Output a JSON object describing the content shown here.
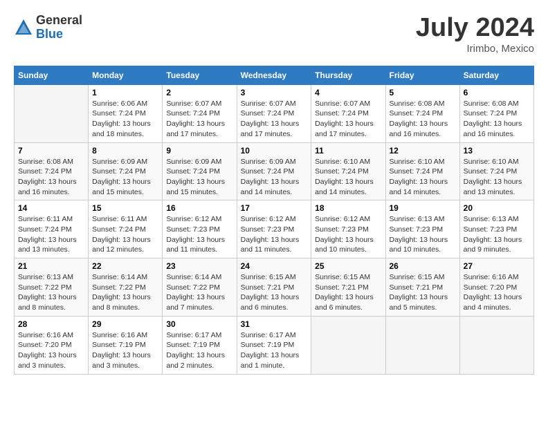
{
  "header": {
    "logo_general": "General",
    "logo_blue": "Blue",
    "month": "July 2024",
    "location": "Irimbo, Mexico"
  },
  "days_of_week": [
    "Sunday",
    "Monday",
    "Tuesday",
    "Wednesday",
    "Thursday",
    "Friday",
    "Saturday"
  ],
  "weeks": [
    [
      {
        "day": "",
        "sunrise": "",
        "sunset": "",
        "daylight": ""
      },
      {
        "day": "1",
        "sunrise": "Sunrise: 6:06 AM",
        "sunset": "Sunset: 7:24 PM",
        "daylight": "Daylight: 13 hours and 18 minutes."
      },
      {
        "day": "2",
        "sunrise": "Sunrise: 6:07 AM",
        "sunset": "Sunset: 7:24 PM",
        "daylight": "Daylight: 13 hours and 17 minutes."
      },
      {
        "day": "3",
        "sunrise": "Sunrise: 6:07 AM",
        "sunset": "Sunset: 7:24 PM",
        "daylight": "Daylight: 13 hours and 17 minutes."
      },
      {
        "day": "4",
        "sunrise": "Sunrise: 6:07 AM",
        "sunset": "Sunset: 7:24 PM",
        "daylight": "Daylight: 13 hours and 17 minutes."
      },
      {
        "day": "5",
        "sunrise": "Sunrise: 6:08 AM",
        "sunset": "Sunset: 7:24 PM",
        "daylight": "Daylight: 13 hours and 16 minutes."
      },
      {
        "day": "6",
        "sunrise": "Sunrise: 6:08 AM",
        "sunset": "Sunset: 7:24 PM",
        "daylight": "Daylight: 13 hours and 16 minutes."
      }
    ],
    [
      {
        "day": "7",
        "sunrise": "Sunrise: 6:08 AM",
        "sunset": "Sunset: 7:24 PM",
        "daylight": "Daylight: 13 hours and 16 minutes."
      },
      {
        "day": "8",
        "sunrise": "Sunrise: 6:09 AM",
        "sunset": "Sunset: 7:24 PM",
        "daylight": "Daylight: 13 hours and 15 minutes."
      },
      {
        "day": "9",
        "sunrise": "Sunrise: 6:09 AM",
        "sunset": "Sunset: 7:24 PM",
        "daylight": "Daylight: 13 hours and 15 minutes."
      },
      {
        "day": "10",
        "sunrise": "Sunrise: 6:09 AM",
        "sunset": "Sunset: 7:24 PM",
        "daylight": "Daylight: 13 hours and 14 minutes."
      },
      {
        "day": "11",
        "sunrise": "Sunrise: 6:10 AM",
        "sunset": "Sunset: 7:24 PM",
        "daylight": "Daylight: 13 hours and 14 minutes."
      },
      {
        "day": "12",
        "sunrise": "Sunrise: 6:10 AM",
        "sunset": "Sunset: 7:24 PM",
        "daylight": "Daylight: 13 hours and 14 minutes."
      },
      {
        "day": "13",
        "sunrise": "Sunrise: 6:10 AM",
        "sunset": "Sunset: 7:24 PM",
        "daylight": "Daylight: 13 hours and 13 minutes."
      }
    ],
    [
      {
        "day": "14",
        "sunrise": "Sunrise: 6:11 AM",
        "sunset": "Sunset: 7:24 PM",
        "daylight": "Daylight: 13 hours and 13 minutes."
      },
      {
        "day": "15",
        "sunrise": "Sunrise: 6:11 AM",
        "sunset": "Sunset: 7:24 PM",
        "daylight": "Daylight: 13 hours and 12 minutes."
      },
      {
        "day": "16",
        "sunrise": "Sunrise: 6:12 AM",
        "sunset": "Sunset: 7:23 PM",
        "daylight": "Daylight: 13 hours and 11 minutes."
      },
      {
        "day": "17",
        "sunrise": "Sunrise: 6:12 AM",
        "sunset": "Sunset: 7:23 PM",
        "daylight": "Daylight: 13 hours and 11 minutes."
      },
      {
        "day": "18",
        "sunrise": "Sunrise: 6:12 AM",
        "sunset": "Sunset: 7:23 PM",
        "daylight": "Daylight: 13 hours and 10 minutes."
      },
      {
        "day": "19",
        "sunrise": "Sunrise: 6:13 AM",
        "sunset": "Sunset: 7:23 PM",
        "daylight": "Daylight: 13 hours and 10 minutes."
      },
      {
        "day": "20",
        "sunrise": "Sunrise: 6:13 AM",
        "sunset": "Sunset: 7:23 PM",
        "daylight": "Daylight: 13 hours and 9 minutes."
      }
    ],
    [
      {
        "day": "21",
        "sunrise": "Sunrise: 6:13 AM",
        "sunset": "Sunset: 7:22 PM",
        "daylight": "Daylight: 13 hours and 8 minutes."
      },
      {
        "day": "22",
        "sunrise": "Sunrise: 6:14 AM",
        "sunset": "Sunset: 7:22 PM",
        "daylight": "Daylight: 13 hours and 8 minutes."
      },
      {
        "day": "23",
        "sunrise": "Sunrise: 6:14 AM",
        "sunset": "Sunset: 7:22 PM",
        "daylight": "Daylight: 13 hours and 7 minutes."
      },
      {
        "day": "24",
        "sunrise": "Sunrise: 6:15 AM",
        "sunset": "Sunset: 7:21 PM",
        "daylight": "Daylight: 13 hours and 6 minutes."
      },
      {
        "day": "25",
        "sunrise": "Sunrise: 6:15 AM",
        "sunset": "Sunset: 7:21 PM",
        "daylight": "Daylight: 13 hours and 6 minutes."
      },
      {
        "day": "26",
        "sunrise": "Sunrise: 6:15 AM",
        "sunset": "Sunset: 7:21 PM",
        "daylight": "Daylight: 13 hours and 5 minutes."
      },
      {
        "day": "27",
        "sunrise": "Sunrise: 6:16 AM",
        "sunset": "Sunset: 7:20 PM",
        "daylight": "Daylight: 13 hours and 4 minutes."
      }
    ],
    [
      {
        "day": "28",
        "sunrise": "Sunrise: 6:16 AM",
        "sunset": "Sunset: 7:20 PM",
        "daylight": "Daylight: 13 hours and 3 minutes."
      },
      {
        "day": "29",
        "sunrise": "Sunrise: 6:16 AM",
        "sunset": "Sunset: 7:19 PM",
        "daylight": "Daylight: 13 hours and 3 minutes."
      },
      {
        "day": "30",
        "sunrise": "Sunrise: 6:17 AM",
        "sunset": "Sunset: 7:19 PM",
        "daylight": "Daylight: 13 hours and 2 minutes."
      },
      {
        "day": "31",
        "sunrise": "Sunrise: 6:17 AM",
        "sunset": "Sunset: 7:19 PM",
        "daylight": "Daylight: 13 hours and 1 minute."
      },
      {
        "day": "",
        "sunrise": "",
        "sunset": "",
        "daylight": ""
      },
      {
        "day": "",
        "sunrise": "",
        "sunset": "",
        "daylight": ""
      },
      {
        "day": "",
        "sunrise": "",
        "sunset": "",
        "daylight": ""
      }
    ]
  ]
}
